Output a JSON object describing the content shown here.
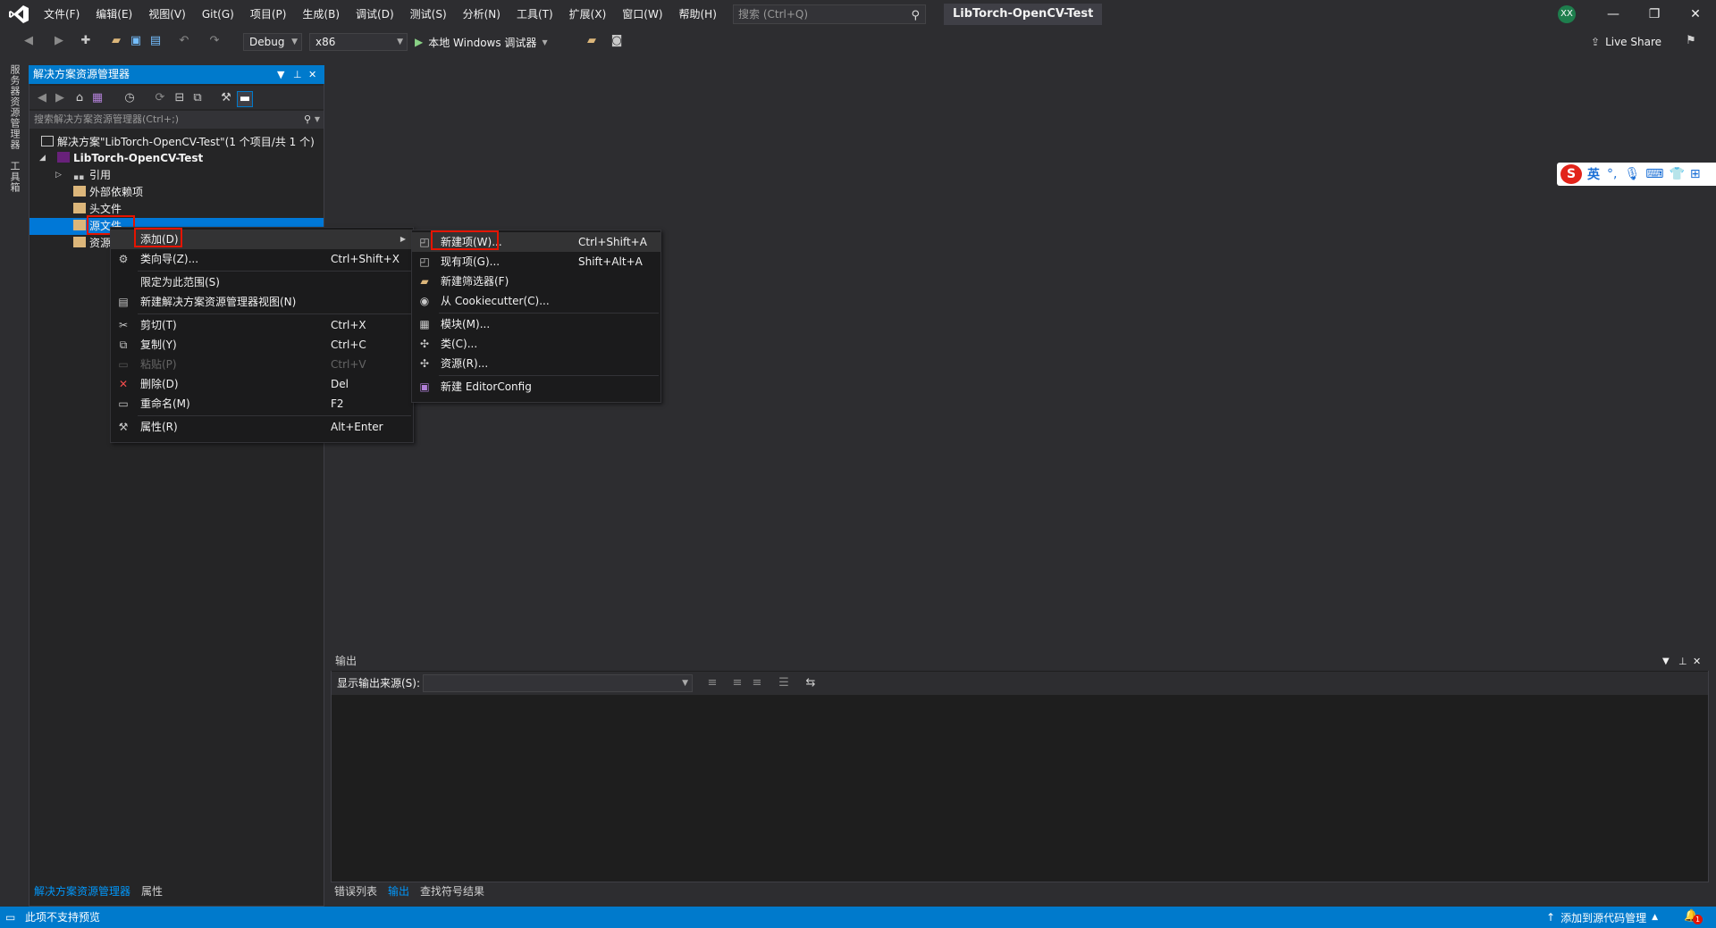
{
  "titlebar": {
    "menu": [
      "文件(F)",
      "编辑(E)",
      "视图(V)",
      "Git(G)",
      "项目(P)",
      "生成(B)",
      "调试(D)",
      "测试(S)",
      "分析(N)",
      "工具(T)",
      "扩展(X)",
      "窗口(W)",
      "帮助(H)"
    ],
    "search_placeholder": "搜索 (Ctrl+Q)",
    "solution_title": "LibTorch-OpenCV-Test",
    "avatar": "XX"
  },
  "toolbar": {
    "config": "Debug",
    "platform": "x86",
    "run_label": "本地 Windows 调试器",
    "live_share": "Live Share"
  },
  "sidestrip": {
    "tab1": "服务器资源管理器",
    "tab2": "工具箱"
  },
  "solution_explorer": {
    "title": "解决方案资源管理器",
    "search_placeholder": "搜索解决方案资源管理器(Ctrl+;)",
    "tree": {
      "solution": "解决方案\"LibTorch-OpenCV-Test\"(1 个项目/共 1 个)",
      "project": "LibTorch-OpenCV-Test",
      "references": "引用",
      "external": "外部依赖项",
      "headers": "头文件",
      "sources": "源文件",
      "resources": "资源"
    },
    "bottom_tabs": [
      "解决方案资源管理器",
      "属性"
    ]
  },
  "context_menu": {
    "items": [
      {
        "label": "添加(D)",
        "shortcut": ""
      },
      {
        "label": "类向导(Z)...",
        "shortcut": "Ctrl+Shift+X"
      },
      {
        "label": "限定为此范围(S)",
        "shortcut": ""
      },
      {
        "label": "新建解决方案资源管理器视图(N)",
        "shortcut": ""
      },
      {
        "label": "剪切(T)",
        "shortcut": "Ctrl+X"
      },
      {
        "label": "复制(Y)",
        "shortcut": "Ctrl+C"
      },
      {
        "label": "粘贴(P)",
        "shortcut": "Ctrl+V"
      },
      {
        "label": "删除(D)",
        "shortcut": "Del"
      },
      {
        "label": "重命名(M)",
        "shortcut": "F2"
      },
      {
        "label": "属性(R)",
        "shortcut": "Alt+Enter"
      }
    ]
  },
  "submenu": {
    "items": [
      {
        "label": "新建项(W)...",
        "shortcut": "Ctrl+Shift+A"
      },
      {
        "label": "现有项(G)...",
        "shortcut": "Shift+Alt+A"
      },
      {
        "label": "新建筛选器(F)",
        "shortcut": ""
      },
      {
        "label": "从 Cookiecutter(C)...",
        "shortcut": ""
      },
      {
        "label": "模块(M)...",
        "shortcut": ""
      },
      {
        "label": "类(C)...",
        "shortcut": ""
      },
      {
        "label": "资源(R)...",
        "shortcut": ""
      },
      {
        "label": "新建 EditorConfig",
        "shortcut": ""
      }
    ]
  },
  "output": {
    "title": "输出",
    "source_label": "显示输出来源(S):",
    "source_value": "",
    "bottom_tabs": [
      "错误列表",
      "输出",
      "查找符号结果"
    ]
  },
  "statusbar": {
    "left": "此项不支持预览",
    "right": "添加到源代码管理",
    "notifications": "1"
  },
  "ime": {
    "mode": "英"
  },
  "colors": {
    "accent": "#007acc",
    "highlight_box": "#e51400",
    "selection": "#0078d7"
  }
}
